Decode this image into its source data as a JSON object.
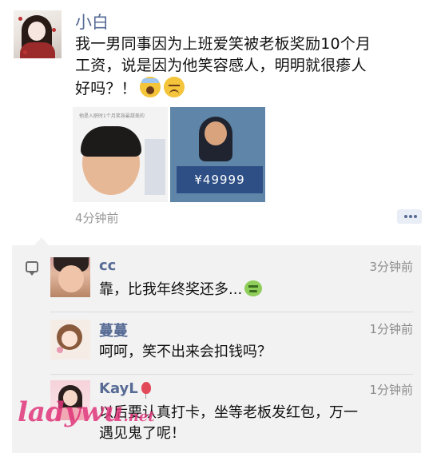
{
  "post": {
    "author": "小白",
    "text_line1": "我一男同事因为上班爱笑被老板奖励10个月",
    "text_line2": "工资，说是因为他笑容感人，明明就很瘆人",
    "text_line3": "好吗？！",
    "emojis": [
      "scream-emoji",
      "sad-emoji"
    ],
    "photo_left_caption": "他是入职时1个月笑容最甜美的",
    "photo_right_sign": "¥49999",
    "time": "4分钟前"
  },
  "comments": [
    {
      "name": "cc",
      "time": "3分钟前",
      "text": "靠，比我年终奖还多...",
      "icon": "angry-sticker"
    },
    {
      "name": "蔓蔓",
      "time": "1分钟前",
      "text": "呵呵，笑不出来会扣钱吗？"
    },
    {
      "name": "KayL",
      "time": "1分钟前",
      "text_line1": "以后要认真打卡，坐等老板发红包，万一",
      "text_line2": "遇见鬼了呢！",
      "icon": "balloon"
    }
  ],
  "watermark": {
    "text": "ladywu",
    "suffix": ".net"
  },
  "colors": {
    "link": "#576b95",
    "comment_bg": "#f2f2f2",
    "time": "#999999"
  }
}
